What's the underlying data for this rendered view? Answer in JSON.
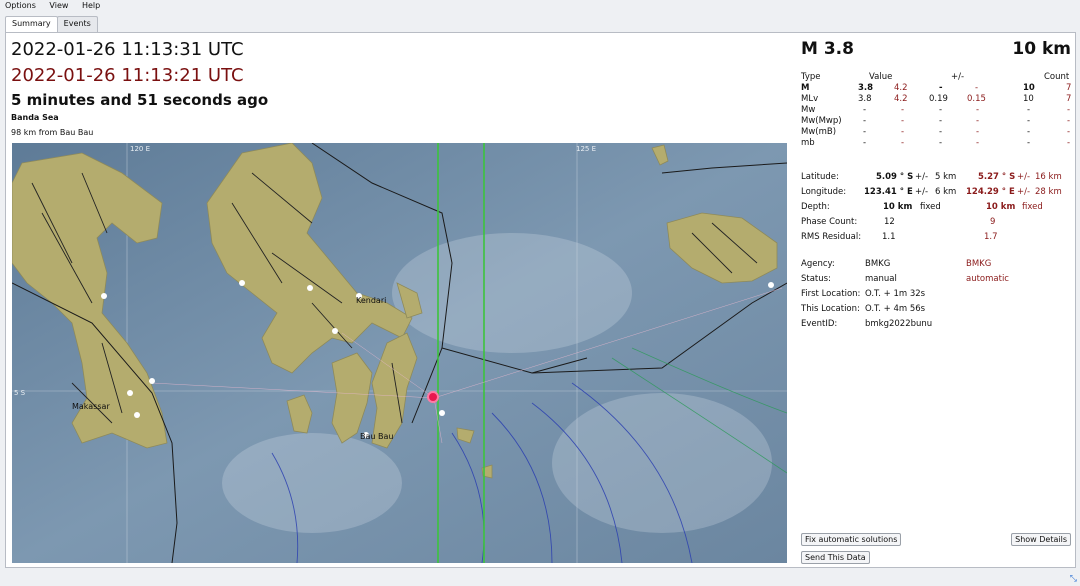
{
  "menu": {
    "items": [
      "Options",
      "View",
      "Help"
    ]
  },
  "tabs": [
    {
      "label": "Summary",
      "active": true
    },
    {
      "label": "Events",
      "active": false
    }
  ],
  "header": {
    "time_primary": "2022-01-26 11:13:31 UTC",
    "time_secondary": "2022-01-26 11:13:21 UTC",
    "elapsed": "5 minutes and 51 seconds ago",
    "region": "Banda Sea",
    "distance": "98 km from Bau Bau"
  },
  "map": {
    "grid_labels": {
      "lon_120": "120 E",
      "lon_125": "125 E",
      "lat_5": "5 S"
    },
    "places": [
      "Kendari",
      "Makassar",
      "Bau Bau"
    ]
  },
  "summary": {
    "magnitude": "M 3.8",
    "depth": "10 km"
  },
  "magnitudes": {
    "headers": {
      "type": "Type",
      "value": "Value",
      "pm": "+/-",
      "count": "Count"
    },
    "rows": [
      {
        "type": "M",
        "v1": "3.8",
        "v2": "4.2",
        "pm1": "-",
        "pm2": "-",
        "c1": "10",
        "c2": "7"
      },
      {
        "type": "MLv",
        "v1": "3.8",
        "v2": "4.2",
        "pm1": "0.19",
        "pm2": "0.15",
        "c1": "10",
        "c2": "7"
      },
      {
        "type": "Mw",
        "v1": "-",
        "v2": "-",
        "pm1": "-",
        "pm2": "-",
        "c1": "-",
        "c2": "-"
      },
      {
        "type": "Mw(Mwp)",
        "v1": "-",
        "v2": "-",
        "pm1": "-",
        "pm2": "-",
        "c1": "-",
        "c2": "-"
      },
      {
        "type": "Mw(mB)",
        "v1": "-",
        "v2": "-",
        "pm1": "-",
        "pm2": "-",
        "c1": "-",
        "c2": "-"
      },
      {
        "type": "mb",
        "v1": "-",
        "v2": "-",
        "pm1": "-",
        "pm2": "-",
        "c1": "-",
        "c2": "-"
      }
    ]
  },
  "location": {
    "latitude": {
      "label": "Latitude:",
      "v1": "5.09 ° S",
      "pm1": "+/-",
      "e1": "5 km",
      "v2": "5.27 ° S",
      "pm2": "+/-",
      "e2": "16 km"
    },
    "longitude": {
      "label": "Longitude:",
      "v1": "123.41 ° E",
      "pm1": "+/-",
      "e1": "6 km",
      "v2": "124.29 ° E",
      "pm2": "+/-",
      "e2": "28 km"
    },
    "depth": {
      "label": "Depth:",
      "v1": "10 km",
      "f1": "fixed",
      "v2": "10 km",
      "f2": "fixed"
    },
    "phase_count": {
      "label": "Phase Count:",
      "v1": "12",
      "v2": "9"
    },
    "rms": {
      "label": "RMS Residual:",
      "v1": "1.1",
      "v2": "1.7"
    }
  },
  "info": {
    "agency": {
      "label": "Agency:",
      "v1": "BMKG",
      "v2": "BMKG"
    },
    "status": {
      "label": "Status:",
      "v1": "manual",
      "v2": "automatic"
    },
    "first_location": {
      "label": "First Location:",
      "v1": "O.T. + 1m 32s"
    },
    "this_location": {
      "label": "This Location:",
      "v1": "O.T. + 4m 56s"
    },
    "event_id": {
      "label": "EventID:",
      "v1": "bmkg2022bunu"
    }
  },
  "buttons": {
    "fix": "Fix automatic solutions",
    "send": "Send This Data",
    "details": "Show Details"
  },
  "colors": {
    "secondary_time": "#7a1010",
    "epicenter": "#e8174f",
    "green_line": "#3cc43c"
  }
}
